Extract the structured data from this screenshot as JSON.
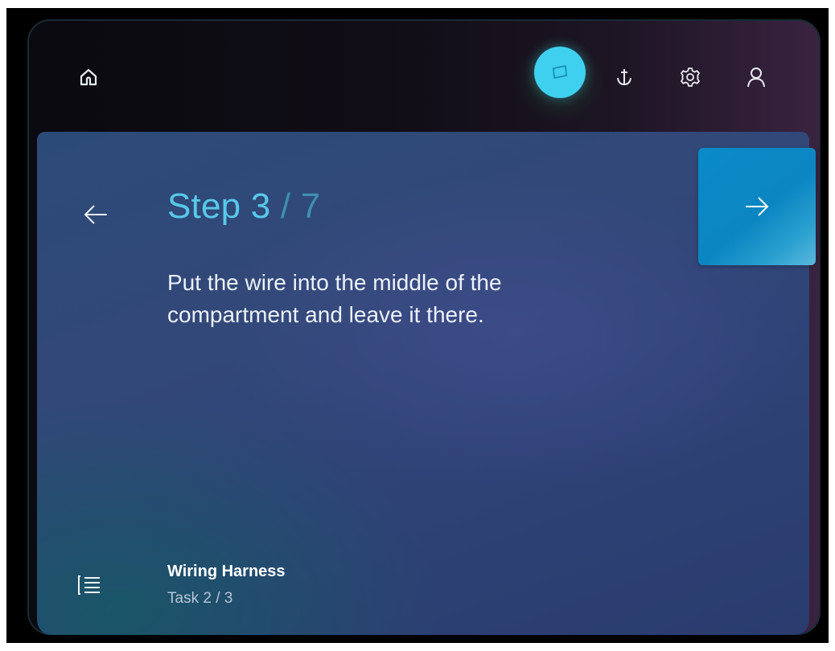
{
  "toolbar": {
    "icons": [
      "home-icon",
      "window-icon",
      "anchor-icon",
      "gear-icon",
      "user-icon"
    ],
    "active_icon": "window-icon",
    "active_color": "#3fd0f0"
  },
  "step": {
    "label": "Step 3",
    "total": " / 7",
    "instruction": "Put the wire into the middle of the compartment and leave it there."
  },
  "navigation": {
    "back_icon": "arrow-left-icon",
    "next_icon": "arrow-right-icon",
    "next_color": "#0b86c2"
  },
  "task": {
    "name": "Wiring Harness",
    "progress": "Task 2 / 3",
    "list_icon": "list-icon"
  }
}
